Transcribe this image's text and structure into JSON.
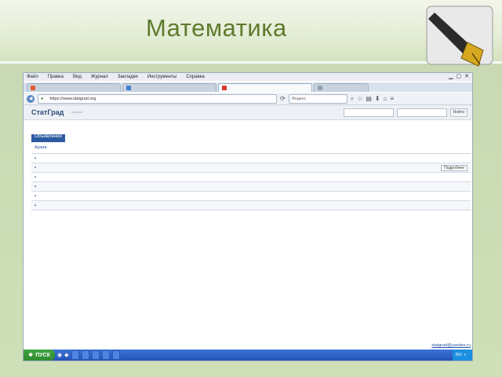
{
  "slide": {
    "title": "Математика"
  },
  "browser": {
    "menu": [
      "Файл",
      "Правка",
      "Вид",
      "Журнал",
      "Закладки",
      "Инструменты",
      "Справка"
    ],
    "tabs": [
      {
        "label": "",
        "active": false,
        "color": "#e25c2c"
      },
      {
        "label": "",
        "active": false,
        "color": "#3f7fcf"
      },
      {
        "label": "",
        "active": true,
        "color": "#d7372f"
      },
      {
        "label": "",
        "active": false,
        "color": "#8fa0b4"
      }
    ],
    "url": "https://www.statgrad.org",
    "url_site": "",
    "search_placeholder": "Яндекс"
  },
  "site": {
    "logo": "СтатГрад",
    "nav": [
      {
        "label": "",
        "active": true
      },
      {
        "label": "",
        "active": false
      }
    ],
    "search_placeholders": [
      "",
      ""
    ],
    "login_label": "Войти",
    "info": "",
    "tabs": [
      {
        "label": "Объявления",
        "active": true
      },
      {
        "label": "",
        "active": false
      },
      {
        "label": "",
        "active": false
      },
      {
        "label": "",
        "active": false
      },
      {
        "label": "",
        "active": false
      },
      {
        "label": "",
        "active": false
      }
    ],
    "archive": "Архив",
    "news": [
      {
        "date": "",
        "text": "",
        "more": ""
      },
      {
        "date": "",
        "text": "",
        "more": "Подробнее"
      },
      {
        "date": "",
        "text": "",
        "more": ""
      },
      {
        "date": "",
        "text": "",
        "more": ""
      },
      {
        "date": "",
        "text": "",
        "more": ""
      },
      {
        "date": "",
        "text": "",
        "more": ""
      }
    ],
    "footer_left": "",
    "footer_right": "",
    "footer_email": "statgrad@yandex.ru"
  },
  "taskbar": {
    "start": "ПУСК",
    "tasks": [
      {
        "label": "",
        "active": false
      },
      {
        "label": "",
        "active": false
      },
      {
        "label": "",
        "active": false
      },
      {
        "label": "",
        "active": false
      },
      {
        "label": "",
        "active": false
      }
    ],
    "lang": "RU",
    "time": ""
  }
}
